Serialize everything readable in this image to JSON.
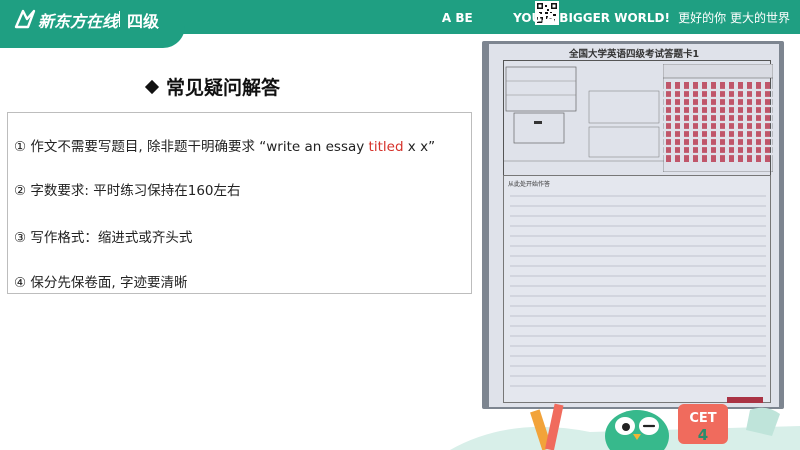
{
  "header": {
    "brand": "新东方在线",
    "level": "四级",
    "slogan_en": "A BE",
    "slogan_en_tail": "YOU,A BIGGER WORLD!",
    "slogan_cn": "更好的你 更大的世界"
  },
  "section": {
    "title": "常见疑问解答"
  },
  "qa": {
    "item1_prefix": "① 作文不需要写题目, 除非题干明确要求 “write an essay ",
    "item1_highlight": "titled",
    "item1_suffix": " x x”",
    "item2": "② 字数要求: 平时练习保持在160左右",
    "item3": "③ 写作格式：缩进式或齐头式",
    "item4": "④ 保分先保卷面, 字迹要清晰"
  },
  "sheet": {
    "title": "全国大学英语四级考试答题卡1",
    "start_label": "从此处开始作答"
  },
  "colors": {
    "brand_green": "#1f9f82",
    "highlight_red": "#d6322b"
  }
}
